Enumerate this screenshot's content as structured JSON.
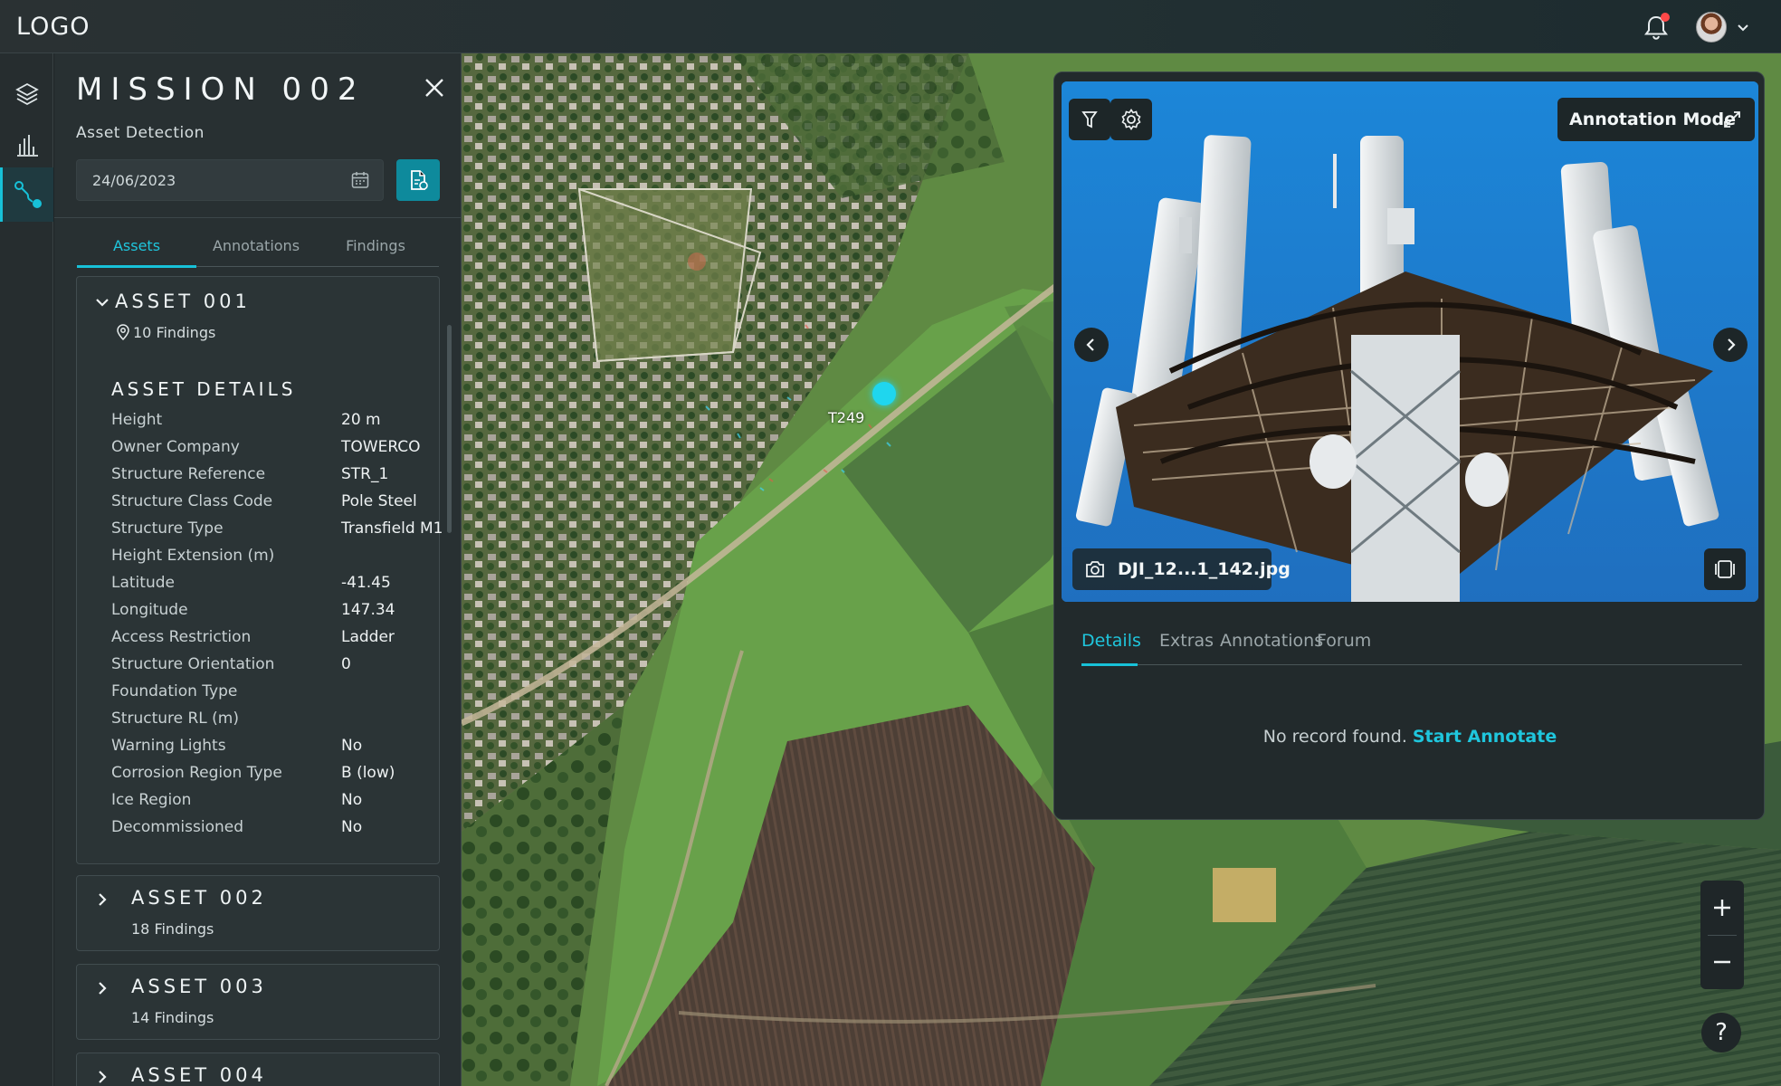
{
  "header": {
    "logo": "LOGO"
  },
  "rail": {
    "items": [
      "layers-icon",
      "chart-icon",
      "route-icon"
    ]
  },
  "mission": {
    "title": "MISSION 002",
    "subtitle": "Asset Detection",
    "date": "24/06/2023",
    "tabs": [
      "Assets",
      "Annotations",
      "Findings"
    ],
    "active_tab": "Assets"
  },
  "assets": [
    {
      "name": "ASSET 001",
      "findings": "10 Findings",
      "expanded": true,
      "details_title": "ASSET DETAILS",
      "details": [
        {
          "k": "Height",
          "v": "20 m"
        },
        {
          "k": "Owner Company",
          "v": "TOWERCO"
        },
        {
          "k": "Structure Reference",
          "v": "STR_1"
        },
        {
          "k": "Structure Class Code",
          "v": "Pole Steel"
        },
        {
          "k": "Structure Type",
          "v": "Transfield M1"
        },
        {
          "k": "Height Extension (m)",
          "v": ""
        },
        {
          "k": "Latitude",
          "v": "-41.45"
        },
        {
          "k": "Longitude",
          "v": "147.34"
        },
        {
          "k": "Access Restriction",
          "v": "Ladder"
        },
        {
          "k": "Structure Orientation",
          "v": "0"
        },
        {
          "k": "Foundation Type",
          "v": ""
        },
        {
          "k": "Structure RL (m)",
          "v": ""
        },
        {
          "k": "Warning Lights",
          "v": "No"
        },
        {
          "k": "Corrosion Region Type",
          "v": "B (low)"
        },
        {
          "k": "Ice Region",
          "v": "No"
        },
        {
          "k": "Decommissioned",
          "v": "No"
        }
      ]
    },
    {
      "name": "ASSET 002",
      "findings": "18 Findings",
      "expanded": false
    },
    {
      "name": "ASSET 003",
      "findings": "14 Findings",
      "expanded": false
    },
    {
      "name": "ASSET 004",
      "findings": "",
      "expanded": false
    }
  ],
  "map": {
    "marker_label": "T249",
    "zoom_in": "+",
    "zoom_out": "−",
    "help": "?"
  },
  "viewer": {
    "annotation_mode": "Annotation Mode",
    "file_name": "DJI_12...1_142.jpg",
    "tabs": [
      "Details",
      "Extras",
      "Annotations",
      "Forum"
    ],
    "active_tab": "Details",
    "empty_text": "No record found.",
    "empty_action": "Start Annotate"
  },
  "colors": {
    "accent": "#17c1d8",
    "panel": "#283032",
    "topbar": "#2a3133"
  }
}
